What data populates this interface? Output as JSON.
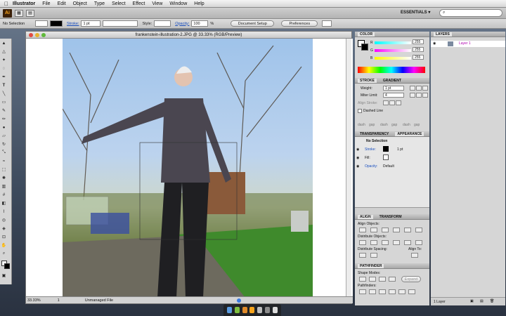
{
  "menubar": {
    "app_name": "Illustrator",
    "items": [
      "File",
      "Edit",
      "Object",
      "Type",
      "Select",
      "Effect",
      "View",
      "Window",
      "Help"
    ]
  },
  "appbar": {
    "logo": "Ai",
    "workspace": "ESSENTIALS ▾",
    "search_placeholder": ""
  },
  "controlbar": {
    "selection": "No Selection",
    "stroke_label": "Stroke:",
    "stroke_value": "1 pt",
    "style_label": "Style:",
    "opacity_label": "Opacity:",
    "opacity_value": "100",
    "opacity_unit": "%",
    "document_setup": "Document Setup",
    "preferences": "Preferences"
  },
  "document": {
    "title": "frankenstein-illustration-2.JPG @ 33.33% (RGB/Preview)",
    "zoom": "33.33%",
    "page": "1",
    "status": "Unmanaged File"
  },
  "color_panel": {
    "title": "COLOR",
    "channels": [
      {
        "label": "R",
        "value": "255"
      },
      {
        "label": "G",
        "value": "255"
      },
      {
        "label": "B",
        "value": "255"
      }
    ]
  },
  "stroke_panel": {
    "tabs": [
      "STROKE",
      "GRADIENT"
    ],
    "weight_label": "Weight:",
    "weight_value": "1 pt",
    "miter_label": "Miter Limit:",
    "miter_value": "4",
    "align_label": "Align Stroke:",
    "dashed_label": "Dashed Line",
    "dash_fields": [
      "dash",
      "gap",
      "dash",
      "gap",
      "dash",
      "gap"
    ]
  },
  "appearance_panel": {
    "tabs": [
      "TRANSPARENCY",
      "APPEARANCE"
    ],
    "header": "No Selection",
    "stroke_label": "Stroke:",
    "stroke_value": "1 pt",
    "fill_label": "Fill:",
    "opacity_label": "Opacity:",
    "opacity_value": "Default"
  },
  "align_panel": {
    "tabs": [
      "ALIGN",
      "TRANSFORM"
    ],
    "align_objects": "Align Objects:",
    "distribute_objects": "Distribute Objects:",
    "distribute_spacing": "Distribute Spacing:",
    "align_to": "Align To:"
  },
  "pathfinder_panel": {
    "title": "PATHFINDER",
    "shape_modes": "Shape Modes:",
    "expand": "Expand",
    "pathfinders": "Pathfinders:"
  },
  "layers_panel": {
    "title": "LAYERS",
    "layer_name": "Layer 1",
    "footer": "1 Layer"
  }
}
